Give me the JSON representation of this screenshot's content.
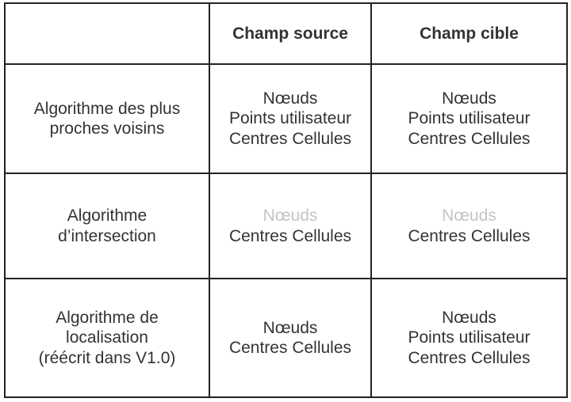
{
  "header": {
    "corner": "",
    "source_label": "Champ source",
    "target_label": "Champ cible"
  },
  "rows": [
    {
      "name_lines": [
        "Algorithme des plus",
        "proches voisins"
      ],
      "source": [
        "Nœuds",
        "Points utilisateur",
        "Centres Cellules"
      ],
      "target": [
        "Nœuds",
        "Points utilisateur",
        "Centres Cellules"
      ]
    },
    {
      "name_lines": [
        "Algorithme",
        "d’intersection"
      ],
      "source_dimmed": "Nœuds",
      "source": [
        "Centres Cellules"
      ],
      "target_dimmed": "Nœuds",
      "target": [
        "Centres Cellules"
      ]
    },
    {
      "name_lines": [
        "Algorithme de",
        "localisation",
        "(réécrit dans V1.0)"
      ],
      "source": [
        "Nœuds",
        "Centres Cellules"
      ],
      "target": [
        "Nœuds",
        "Points utilisateur",
        "Centres Cellules"
      ]
    }
  ],
  "colors": {
    "text": "#333333",
    "dimmed_text": "#c4c4c4",
    "border": "#222222"
  }
}
